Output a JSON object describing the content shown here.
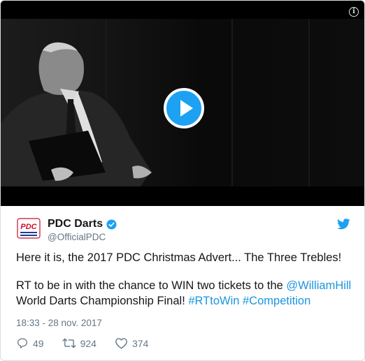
{
  "media": {
    "info_icon": "info-icon",
    "play_icon": "play-icon",
    "accent": "#1da1f2"
  },
  "author": {
    "display_name": "PDC Darts",
    "handle": "@OfficialPDC",
    "avatar_text": "PDC",
    "verified_icon": "verified-badge-icon"
  },
  "tweet": {
    "line1": "Here it is, the 2017 PDC Christmas Advert... The Three Trebles!",
    "line2_start": "RT to be in with the chance to WIN two tickets to the ",
    "mention": "@WilliamHill",
    "line2_mid": " World Darts Championship Final! ",
    "hashtag1": "#RTtoWin",
    "hashtag2": "#Competition",
    "link_color": "#1b95e0"
  },
  "meta": {
    "timestamp": "18:33 - 28 nov. 2017"
  },
  "actions": {
    "replies": "49",
    "retweets": "924",
    "likes": "374"
  }
}
